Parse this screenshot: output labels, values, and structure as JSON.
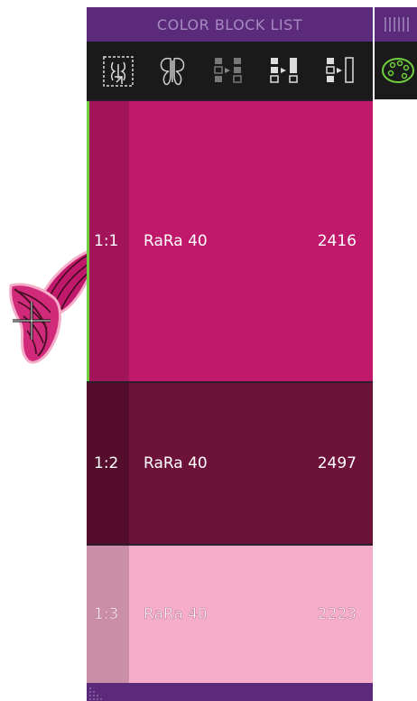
{
  "panel": {
    "title": "COLOR BLOCK LIST"
  },
  "toolbar": {
    "tools": [
      {
        "icon": "select-design-icon"
      },
      {
        "icon": "butterfly-outline-icon"
      },
      {
        "icon": "merge-blocks-icon"
      },
      {
        "icon": "move-block-icon"
      },
      {
        "icon": "split-block-icon"
      }
    ]
  },
  "blocks": [
    {
      "index": "1:1",
      "thread": "RaRa 40",
      "code": "2416",
      "color": "#c0186b",
      "selected": true
    },
    {
      "index": "1:2",
      "thread": "RaRa 40",
      "code": "2497",
      "color": "#6d1238",
      "selected": false
    },
    {
      "index": "1:3",
      "thread": "RaRa 40",
      "code": "2223",
      "color": "#f5adc9",
      "selected": false
    }
  ],
  "side_tab": {
    "icon": "color-palette-icon"
  },
  "colors": {
    "header": "#5c2a7a",
    "toolbar": "#1a1a1a",
    "selection": "#6fcf3f",
    "palette_icon": "#6fcf3f"
  }
}
